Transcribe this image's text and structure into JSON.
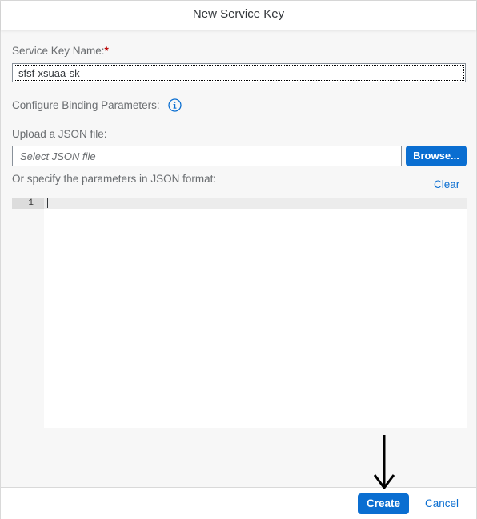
{
  "dialog": {
    "title": "New Service Key"
  },
  "form": {
    "service_key_name": {
      "label": "Service Key Name:",
      "required_mark": "*",
      "value": "sfsf-xsuaa-sk"
    },
    "binding_parameters": {
      "label": "Configure Binding Parameters:",
      "info_icon": "info-icon"
    },
    "upload": {
      "label": "Upload a JSON file:",
      "placeholder": "Select JSON file",
      "browse_label": "Browse..."
    },
    "json_format": {
      "label": "Or specify the parameters in JSON format:",
      "clear_label": "Clear"
    },
    "editor": {
      "line_numbers": [
        "1"
      ],
      "content": ""
    }
  },
  "footer": {
    "create_label": "Create",
    "cancel_label": "Cancel"
  },
  "colors": {
    "accent": "#0a6ed1",
    "required": "#bb0000",
    "label": "#6a6d70",
    "dialog_background": "#f7f7f7"
  },
  "annotation": {
    "arrow_icon": "down-arrow-icon"
  }
}
